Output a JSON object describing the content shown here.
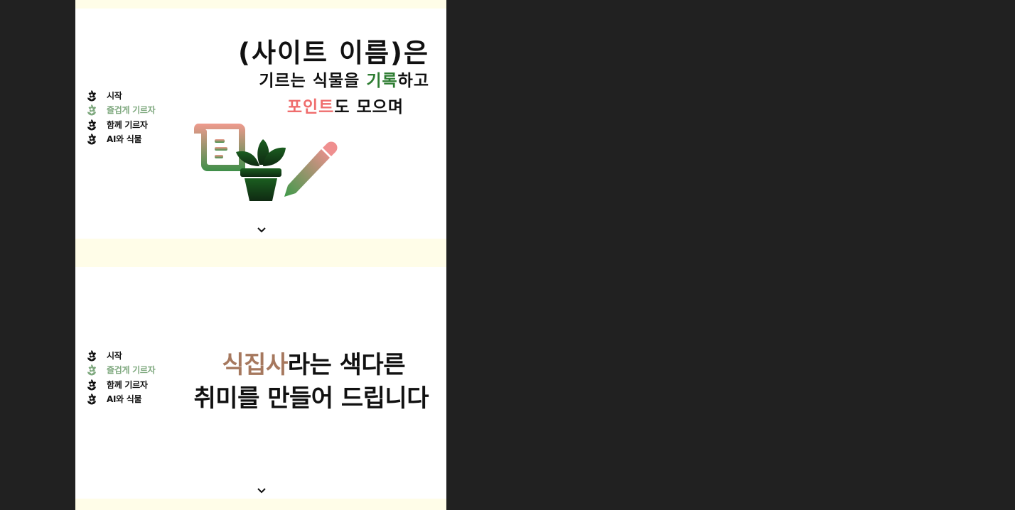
{
  "hero": {
    "site_name": "(사이트 이름)은",
    "line2_prefix": "기르는 식물을 ",
    "line2_highlight": "기록",
    "line2_suffix": "하고",
    "line3_highlight": "포인트",
    "line3_suffix": "도 모으며"
  },
  "hobby": {
    "brand": "식집사",
    "line1_suffix": "라는 색다른",
    "line2": "취미를 만들어 드립니다"
  },
  "nav": {
    "items": [
      {
        "label": "시작",
        "active": false
      },
      {
        "label": "즐겁게 기르자",
        "active": true
      },
      {
        "label": "함께 기르자",
        "active": false
      },
      {
        "label": "AI와 식물",
        "active": false
      }
    ]
  },
  "icons": {
    "nav": "flower-icon",
    "scroll": "chevron-down-icon",
    "illustration": [
      "scroll-icon",
      "potted-plant-icon",
      "pencil-icon"
    ]
  },
  "colors": {
    "page_bg": "#212121",
    "accent_green": "#2e7d32",
    "accent_pink": "#ef6d6d",
    "accent_brown": "#a6785e",
    "nav_active": "#7ea87e",
    "strip": "#fffde8"
  }
}
